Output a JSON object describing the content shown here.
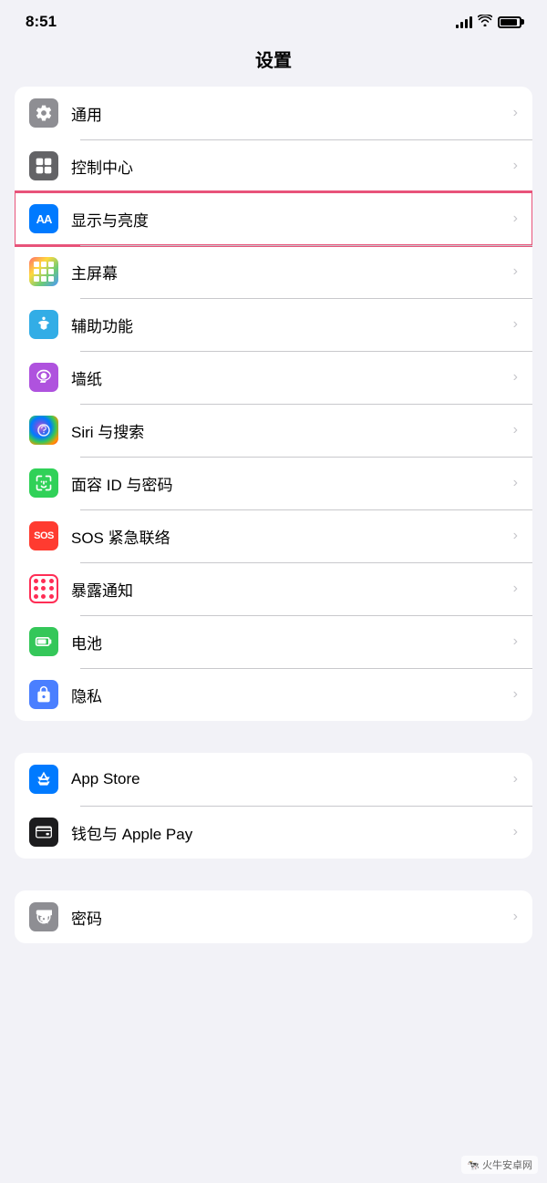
{
  "status": {
    "time": "8:51",
    "signal_label": "signal",
    "wifi_label": "wifi",
    "battery_label": "battery"
  },
  "page": {
    "title": "设置"
  },
  "section1": {
    "items": [
      {
        "id": "general",
        "label": "通用",
        "icon": "gear",
        "bg": "gray",
        "highlighted": false
      },
      {
        "id": "control-center",
        "label": "控制中心",
        "icon": "toggle",
        "bg": "gray2",
        "highlighted": false
      },
      {
        "id": "display",
        "label": "显示与亮度",
        "icon": "aa",
        "bg": "blue",
        "highlighted": true
      },
      {
        "id": "home-screen",
        "label": "主屏幕",
        "icon": "grid",
        "bg": "multicolor",
        "highlighted": false
      },
      {
        "id": "accessibility",
        "label": "辅助功能",
        "icon": "accessibility",
        "bg": "blue2",
        "highlighted": false
      },
      {
        "id": "wallpaper",
        "label": "墙纸",
        "icon": "flower",
        "bg": "purple",
        "highlighted": false
      },
      {
        "id": "siri",
        "label": "Siri 与搜索",
        "icon": "siri",
        "bg": "siri",
        "highlighted": false
      },
      {
        "id": "face-id",
        "label": "面容 ID 与密码",
        "icon": "faceid",
        "bg": "green2",
        "highlighted": false
      },
      {
        "id": "sos",
        "label": "SOS 紧急联络",
        "icon": "sos",
        "bg": "red",
        "highlighted": false
      },
      {
        "id": "exposure",
        "label": "暴露通知",
        "icon": "dots",
        "bg": "pink2",
        "highlighted": false
      },
      {
        "id": "battery",
        "label": "电池",
        "icon": "battery",
        "bg": "green",
        "highlighted": false
      },
      {
        "id": "privacy",
        "label": "隐私",
        "icon": "hand",
        "bg": "blue3",
        "highlighted": false
      }
    ]
  },
  "section2": {
    "items": [
      {
        "id": "app-store",
        "label": "App Store",
        "icon": "appstore",
        "bg": "blue4",
        "highlighted": false
      },
      {
        "id": "wallet",
        "label": "钱包与 Apple Pay",
        "icon": "wallet",
        "bg": "black",
        "highlighted": false
      }
    ]
  },
  "section3": {
    "items": [
      {
        "id": "password",
        "label": "密码",
        "icon": "key",
        "bg": "gray3",
        "highlighted": false
      }
    ]
  },
  "chevron": "›"
}
